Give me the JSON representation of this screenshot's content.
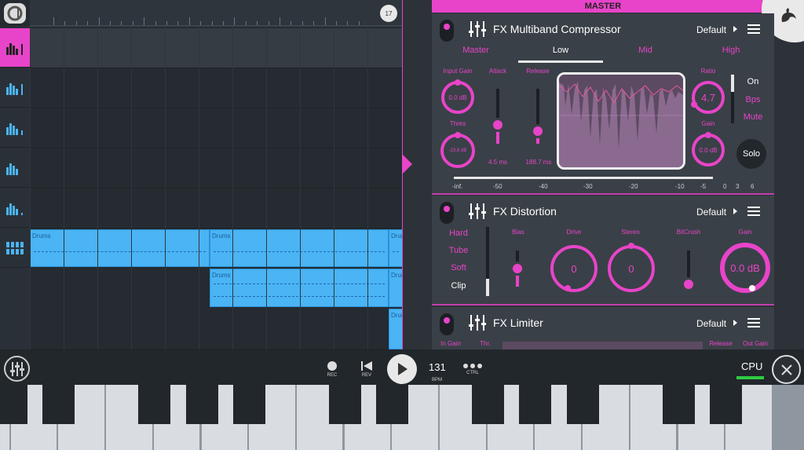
{
  "timeline": {
    "bar_badge": "17"
  },
  "tracks": {
    "clips": [
      {
        "label": "Drums"
      },
      {
        "label": "Drums"
      },
      {
        "label": "Drums"
      },
      {
        "label": "Drums"
      },
      {
        "label": "Drums"
      },
      {
        "label": "Drums"
      }
    ]
  },
  "mixer": {
    "title": "MASTER",
    "multiband": {
      "title": "FX Multiband Compressor",
      "preset": "Default",
      "bands": [
        "Master",
        "Low",
        "Mid",
        "High"
      ],
      "active_band": "Low",
      "input_gain_label": "Input Gain",
      "input_gain_value": "0.0 dB",
      "thres_label": "Thres",
      "thres_value": "-23.6 dB",
      "attack_label": "Attack",
      "attack_value": "4.5 ms",
      "release_label": "Release",
      "release_value": "188.7 ms",
      "ratio_label": "Ratio",
      "ratio_value": "4.7",
      "gain_label": "Gain",
      "gain_value": "0.0 dB",
      "side_options": [
        "On",
        "Bps",
        "Mute"
      ],
      "solo_label": "Solo",
      "scale": [
        "-inf.",
        "-50",
        "-40",
        "-30",
        "-20",
        "-10",
        "-5",
        "0",
        "3",
        "6"
      ],
      "accent_color": "#e844c9"
    },
    "distortion": {
      "title": "FX Distortion",
      "preset": "Default",
      "modes": [
        "Hard",
        "Tube",
        "Soft",
        "Clip"
      ],
      "active_mode": "Clip",
      "bias_label": "Bias",
      "drive_label": "Drive",
      "drive_value": "0",
      "stereo_label": "Stereo",
      "stereo_value": "0",
      "bitcrush_label": "BitCrush",
      "gain_label": "Gain",
      "gain_value": "0.0 dB"
    },
    "limiter": {
      "title": "FX Limiter",
      "preset": "Default",
      "in_gain_label": "In Gain",
      "thr_label": "Thr.",
      "release_label": "Release",
      "out_gain_label": "Out Gain"
    }
  },
  "transport": {
    "rec_label": "REC",
    "rev_label": "REV",
    "bpm_value": "131",
    "bpm_label": "BPM",
    "ctrl_label": "CTRL",
    "cpu_label": "CPU"
  }
}
